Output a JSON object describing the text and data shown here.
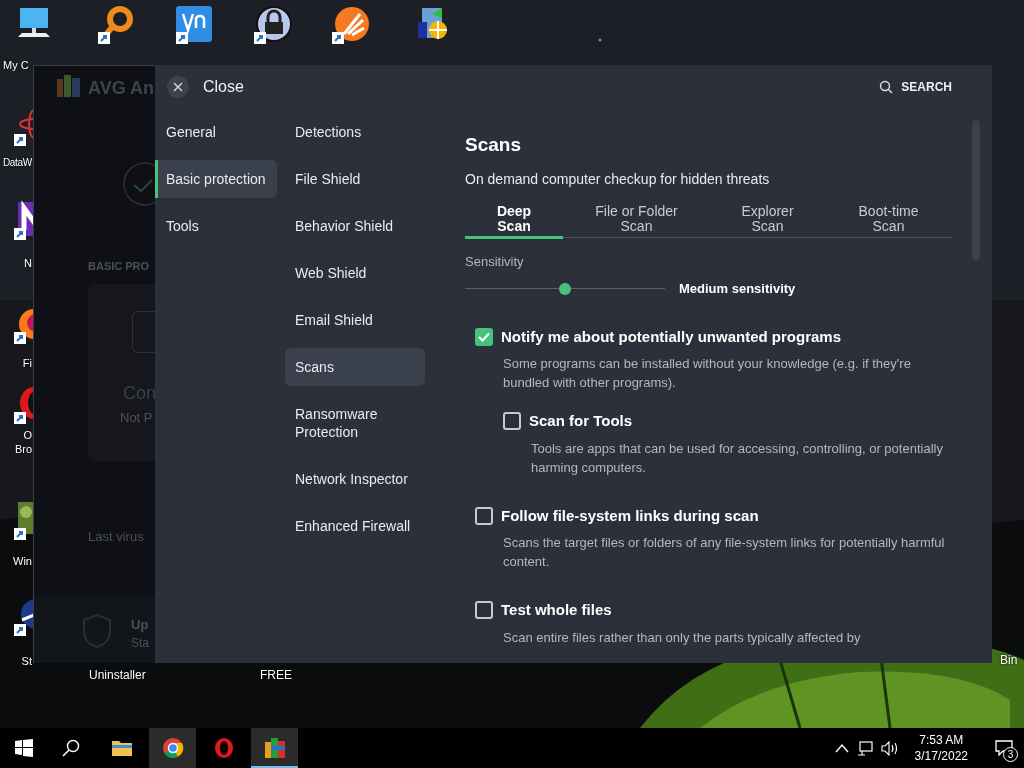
{
  "desktop": {
    "icons": [
      {
        "kind": "computer",
        "label": "My C"
      },
      {
        "kind": "magnifier"
      },
      {
        "kind": "vnc"
      },
      {
        "kind": "padlock"
      },
      {
        "kind": "star"
      },
      {
        "kind": "installer"
      },
      {
        "kind": "atom",
        "label": "DataW"
      },
      {
        "kind": "tile",
        "label": "N"
      },
      {
        "kind": "firefox",
        "label": "Fi"
      },
      {
        "kind": "opera",
        "label": "O\nBro"
      },
      {
        "kind": "tree",
        "label": "Win"
      },
      {
        "kind": "globe",
        "label": "St"
      }
    ],
    "labels": [
      "Uninstaller",
      "FREE",
      "Bin"
    ]
  },
  "background_window": {
    "title": "AVG An",
    "section": "BASIC PRO",
    "status": "Con",
    "status_detail": "Not P",
    "last_scan": "Last virus",
    "update_title": "Up",
    "update_detail": "Sta"
  },
  "settings": {
    "close": "Close",
    "search": "SEARCH",
    "categories": [
      {
        "label": "General",
        "selected": false
      },
      {
        "label": "Basic protection",
        "selected": true
      },
      {
        "label": "Tools",
        "selected": false
      }
    ],
    "sections": [
      {
        "label": "Detections",
        "selected": false
      },
      {
        "label": "File Shield",
        "selected": false
      },
      {
        "label": "Behavior Shield",
        "selected": false
      },
      {
        "label": "Web Shield",
        "selected": false
      },
      {
        "label": "Email Shield",
        "selected": false
      },
      {
        "label": "Scans",
        "selected": true
      },
      {
        "label": "Ransomware Protection",
        "selected": false
      },
      {
        "label": "Network Inspector",
        "selected": false
      },
      {
        "label": "Enhanced Firewall",
        "selected": false
      }
    ],
    "page": {
      "title": "Scans",
      "subtitle": "On demand computer checkup for hidden threats",
      "tabs": [
        {
          "label": "Deep\nScan",
          "selected": true
        },
        {
          "label": "File or Folder\nScan",
          "selected": false
        },
        {
          "label": "Explorer\nScan",
          "selected": false
        },
        {
          "label": "Boot-time\nScan",
          "selected": false
        }
      ],
      "sensitivity": {
        "label": "Sensitivity",
        "level": 0.5,
        "reading": "Medium sensitivity"
      },
      "options": [
        {
          "label": "Notify me about potentially unwanted programs",
          "description": "Some programs can be installed without your knowledge (e.g. if they're bundled with other programs).",
          "checked": true,
          "children": [
            {
              "label": "Scan for Tools",
              "description": "Tools are apps that can be used for accessing, controlling, or potentially harming computers.",
              "checked": false
            }
          ]
        },
        {
          "label": "Follow file-system links during scan",
          "description": "Scans the target files or folders of any file-system links for potentially harmful content.",
          "checked": false
        },
        {
          "label": "Test whole files",
          "description": "Scan entire files rather than only the parts typically affected by",
          "checked": false
        }
      ]
    }
  },
  "taskbar": {
    "apps": [
      {
        "kind": "explorer",
        "hovered": false,
        "selected": false
      },
      {
        "kind": "chrome",
        "hovered": true,
        "selected": false
      },
      {
        "kind": "opera",
        "hovered": false,
        "selected": false
      },
      {
        "kind": "avg",
        "hovered": true,
        "selected": true
      }
    ],
    "time": "7:53 AM",
    "date": "3/17/2022",
    "notifications": "3"
  }
}
